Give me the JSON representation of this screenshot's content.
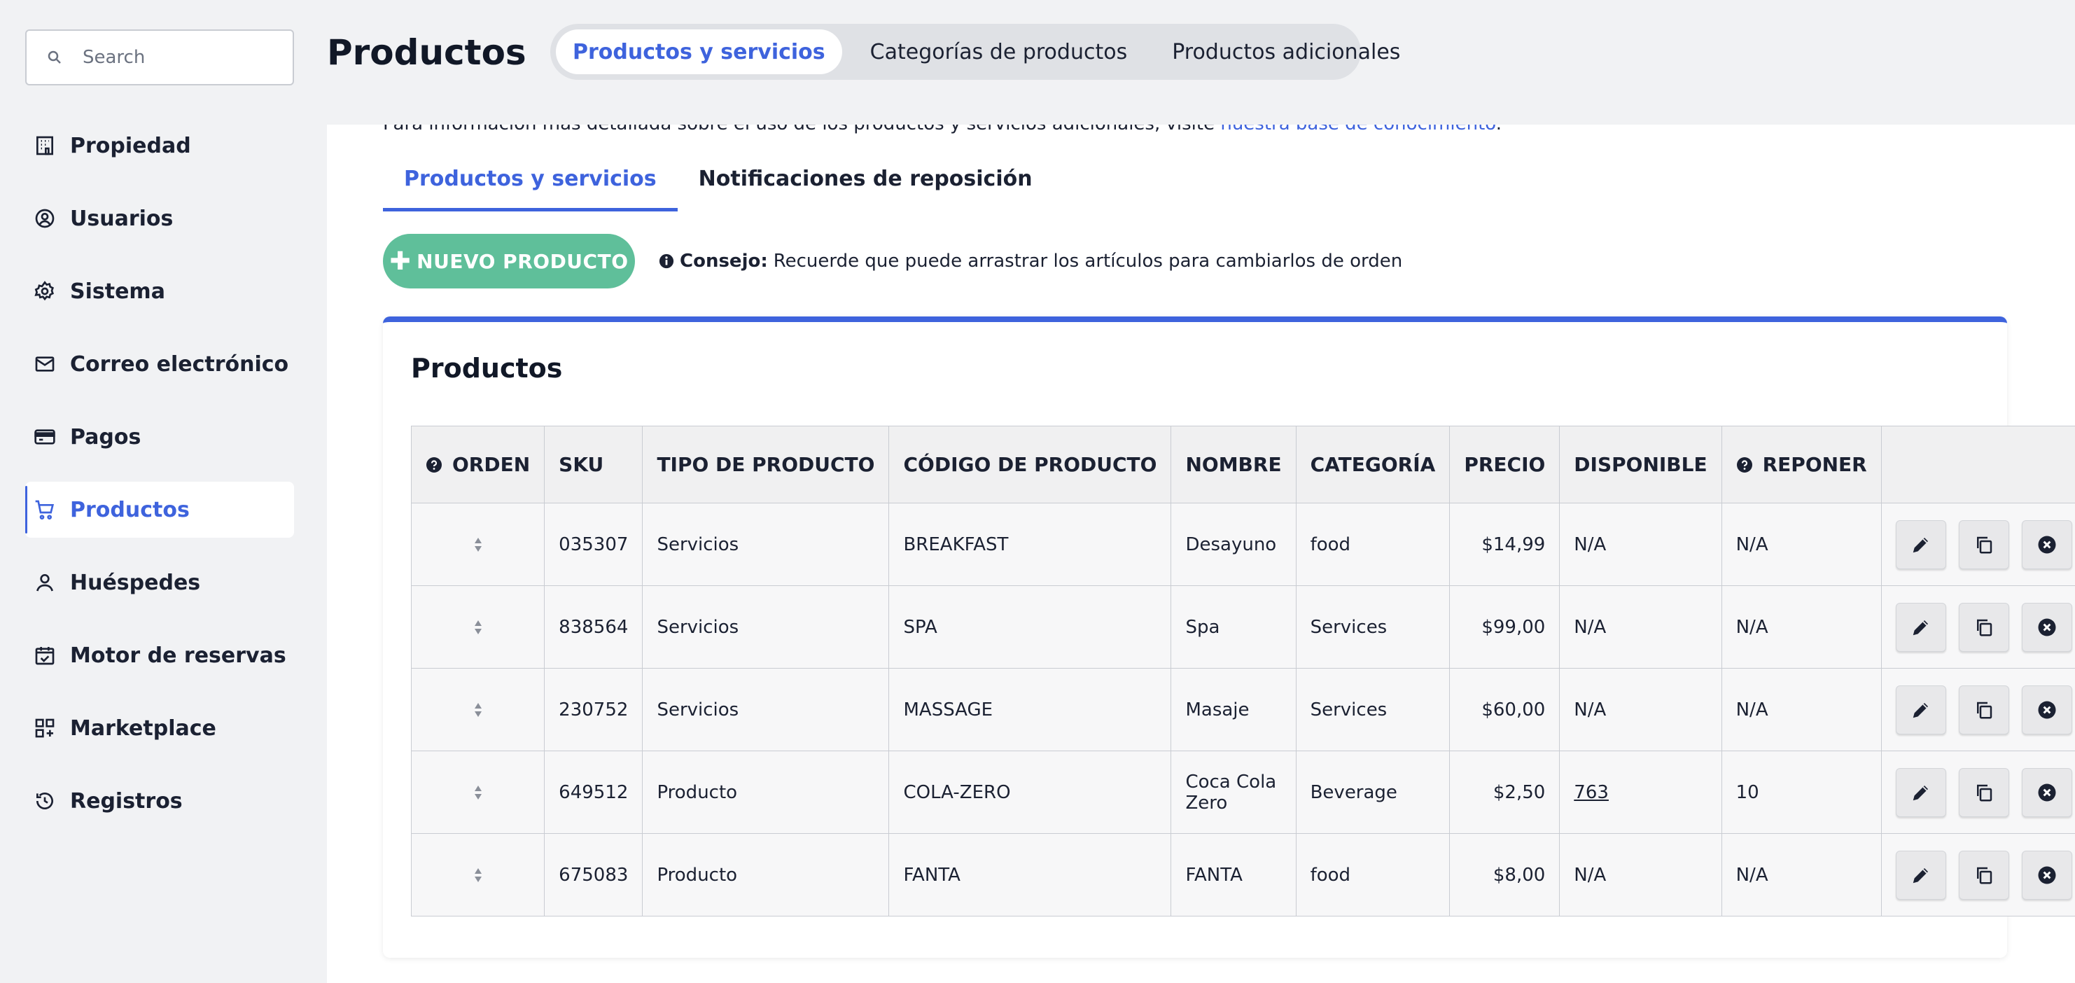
{
  "search": {
    "placeholder": "Search"
  },
  "sidebar": {
    "items": [
      {
        "label": "Propiedad",
        "icon": "building-icon"
      },
      {
        "label": "Usuarios",
        "icon": "user-circle-icon"
      },
      {
        "label": "Sistema",
        "icon": "gear-icon"
      },
      {
        "label": "Correo electrónico",
        "icon": "mail-icon"
      },
      {
        "label": "Pagos",
        "icon": "credit-card-icon"
      },
      {
        "label": "Productos",
        "icon": "cart-icon",
        "active": true
      },
      {
        "label": "Huéspedes",
        "icon": "person-icon"
      },
      {
        "label": "Motor de reservas",
        "icon": "calendar-check-icon"
      },
      {
        "label": "Marketplace",
        "icon": "grid-plus-icon"
      },
      {
        "label": "Registros",
        "icon": "history-icon"
      }
    ]
  },
  "header": {
    "title": "Productos",
    "tabs": [
      {
        "label": "Productos y servicios",
        "active": true
      },
      {
        "label": "Categorías de productos"
      },
      {
        "label": "Productos adicionales"
      }
    ]
  },
  "main": {
    "info_text": "Para información más detallada sobre el uso de los productos y servicios adicionales, visite",
    "info_link": "nuestra base de conocimiento",
    "info_end": ".",
    "sub_tabs": [
      {
        "label": "Productos y servicios",
        "active": true
      },
      {
        "label": "Notificaciones de reposición"
      }
    ],
    "new_button": "NUEVO PRODUCTO",
    "tip_label": "Consejo:",
    "tip_text": "Recuerde que puede arrastrar los artículos para cambiarlos de orden",
    "card_title": "Productos",
    "table": {
      "headers": [
        "ORDEN",
        "SKU",
        "TIPO DE PRODUCTO",
        "CÓDIGO DE PRODUCTO",
        "NOMBRE",
        "CATEGORÍA",
        "PRECIO",
        "DISPONIBLE",
        "REPONER",
        ""
      ],
      "rows": [
        {
          "sku": "035307",
          "tipo": "Servicios",
          "codigo": "BREAKFAST",
          "nombre": "Desayuno",
          "categoria": "food",
          "precio": "$14,99",
          "disponible": "N/A",
          "reponer": "N/A"
        },
        {
          "sku": "838564",
          "tipo": "Servicios",
          "codigo": "SPA",
          "nombre": "Spa",
          "categoria": "Services",
          "precio": "$99,00",
          "disponible": "N/A",
          "reponer": "N/A"
        },
        {
          "sku": "230752",
          "tipo": "Servicios",
          "codigo": "MASSAGE",
          "nombre": "Masaje",
          "categoria": "Services",
          "precio": "$60,00",
          "disponible": "N/A",
          "reponer": "N/A"
        },
        {
          "sku": "649512",
          "tipo": "Producto",
          "codigo": "COLA-ZERO",
          "nombre": "Coca Cola Zero",
          "categoria": "Beverage",
          "precio": "$2,50",
          "disponible": "763",
          "disponible_link": true,
          "reponer": "10"
        },
        {
          "sku": "675083",
          "tipo": "Producto",
          "codigo": "FANTA",
          "nombre": "FANTA",
          "categoria": "food",
          "precio": "$8,00",
          "disponible": "N/A",
          "reponer": "N/A"
        }
      ]
    }
  },
  "colors": {
    "accent": "#3e63dd",
    "success": "#5fbf9a"
  }
}
